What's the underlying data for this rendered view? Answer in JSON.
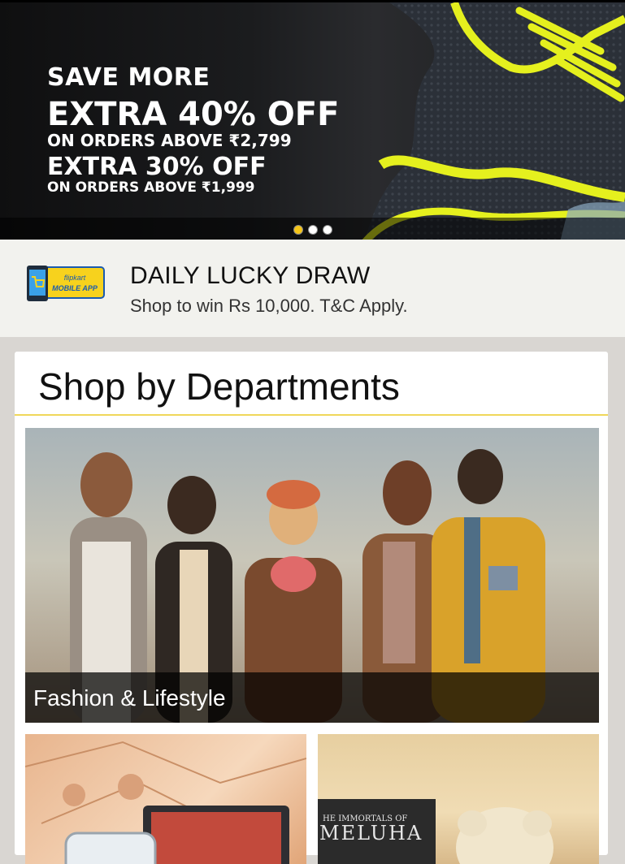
{
  "banner": {
    "line1": "SAVE MORE",
    "line2": "EXTRA 40% OFF",
    "line3": "ON ORDERS ABOVE ₹2,799",
    "line4": "EXTRA 30% OFF",
    "line5": "ON ORDERS ABOVE ₹1,999",
    "carousel": {
      "count": 3,
      "active_index": 0
    },
    "colors": {
      "shoe_accent": "#e5f01e",
      "dot_active": "#f5c518"
    }
  },
  "lucky_draw": {
    "logo": {
      "brand": "flipkart",
      "tag": "MOBILE APP"
    },
    "title": "DAILY LUCKY DRAW",
    "subtitle": "Shop to win Rs 10,000. T&C Apply."
  },
  "departments": {
    "title": "Shop by Departments",
    "items": [
      {
        "label": "Fashion & Lifestyle"
      }
    ],
    "book_tile_text": {
      "line1": "HE IMMORTALS OF",
      "line2": "MELUHA"
    }
  }
}
